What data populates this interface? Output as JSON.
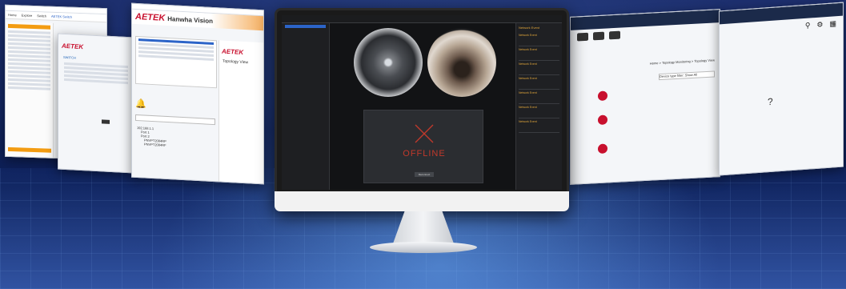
{
  "colors": {
    "brand_red": "#c8102e",
    "offline_red": "#c0392b",
    "select_blue": "#2c64c8"
  },
  "left_far_window": {
    "tabs": [
      "Home",
      "Explore",
      "Switch",
      "AETEK Switch"
    ],
    "logo": "AETEK"
  },
  "left_mid_window": {
    "logo": "AETEK",
    "section_label": "SWITCH",
    "heading": "Topology View"
  },
  "left_near_window": {
    "logo_aetek": "AETEK",
    "logo_hanwha": "Hanwha Vision",
    "secondary_logo": "AETEK",
    "heading": "Topology View",
    "tree_root": "192.168.1.1",
    "tree_items": [
      "Port 1",
      "Port 2",
      "PNVPT2084RP",
      "PNVPT2084RF"
    ]
  },
  "monitor": {
    "status_text": "OFFLINE",
    "retry_button": "Reconnect",
    "event_panel_title": "Network Event",
    "events": [
      "Network Event",
      "Network Event",
      "Network Event",
      "Network Event",
      "Network Event",
      "Network Event",
      "Network Event"
    ]
  },
  "right_windows": {
    "breadcrumb": "Home > Topology Monitoring > Topology View",
    "device_dropdown": "Device type filter: Show All"
  }
}
